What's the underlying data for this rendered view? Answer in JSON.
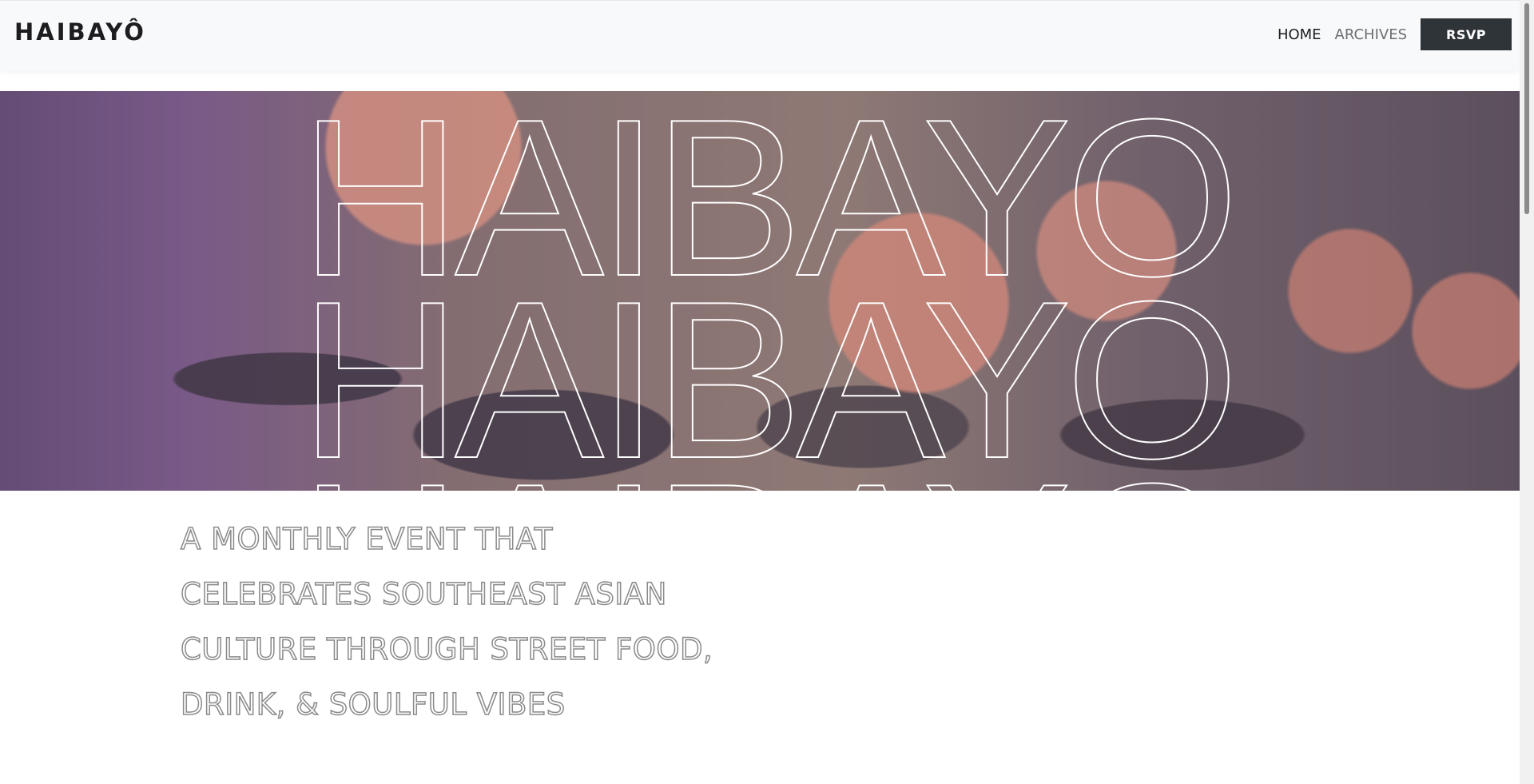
{
  "header": {
    "brand": "HAIBAYÔ",
    "nav": [
      {
        "label": "HOME",
        "active": true
      },
      {
        "label": "ARCHIVES",
        "active": false
      }
    ],
    "rsvp_label": "RSVP"
  },
  "hero": {
    "repeated_word": "HAIBAYO",
    "overlay_color": "#ffffff"
  },
  "tagline": {
    "lines": [
      "A MONTHLY EVENT THAT",
      "CELEBRATES SOUTHEAST ASIAN",
      "CULTURE THROUGH STREET FOOD,",
      "DRINK, & SOULFUL VIBES"
    ]
  },
  "colors": {
    "nav_bg": "#f8f9fa",
    "button_bg": "#2f3439",
    "text_dark": "#1d1d1f",
    "text_muted": "#6b6e72"
  }
}
